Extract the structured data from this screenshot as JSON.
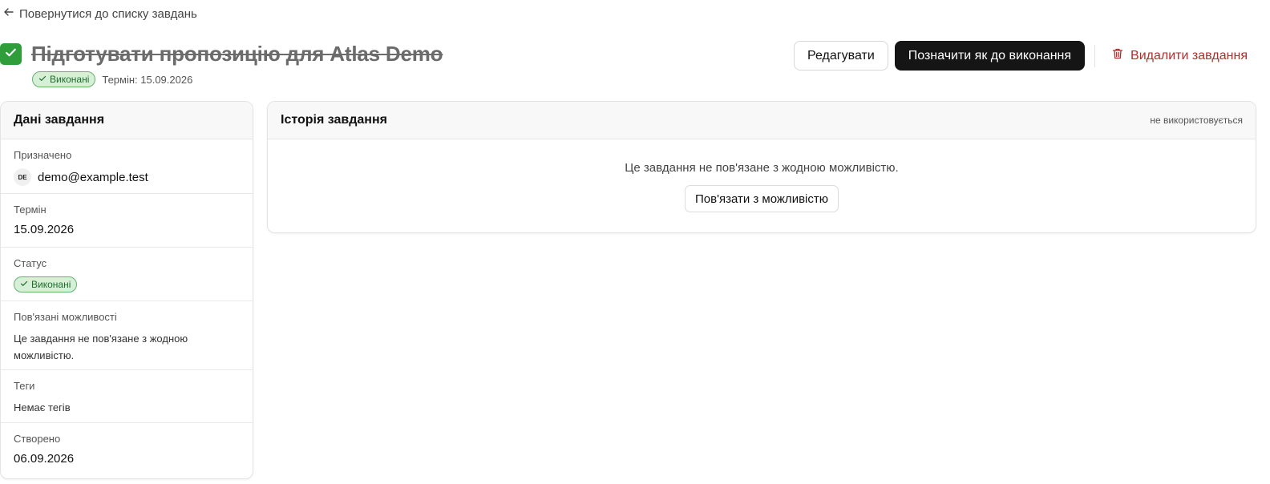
{
  "nav": {
    "back_label": "Повернутися до списку завдань"
  },
  "task": {
    "title": "Підготувати пропозицію для Atlas Demo",
    "completed": true,
    "status_label": "Виконані",
    "due_text": "Термін: 15.09.2026"
  },
  "actions": {
    "edit_label": "Редагувати",
    "mark_todo_label": "Позначити як до виконання",
    "delete_label": "Видалити завдання"
  },
  "details": {
    "header": "Дані завдання",
    "assigned_label": "Призначено",
    "assignee_initials": "DE",
    "assignee_email": "demo@example.test",
    "due_label": "Термін",
    "due_value": "15.09.2026",
    "status_label": "Статус",
    "status_value": "Виконані",
    "linked_label": "Пов'язані можливості",
    "linked_value": "Це завдання не пов'язане з жодною можливістю.",
    "tags_label": "Теги",
    "tags_value": "Немає тегів",
    "created_label": "Створено",
    "created_value": "06.09.2026"
  },
  "history": {
    "header": "Історія завдання",
    "aside": "не використовується",
    "empty_text": "Це завдання не пов'язане з жодною можливістю.",
    "link_button": "Пов'язати з можливістю"
  },
  "colors": {
    "accent_done": "#2e9d3a",
    "badge_bg": "#d6f0d8",
    "danger": "#b32b2b",
    "primary_button": "#151515"
  }
}
